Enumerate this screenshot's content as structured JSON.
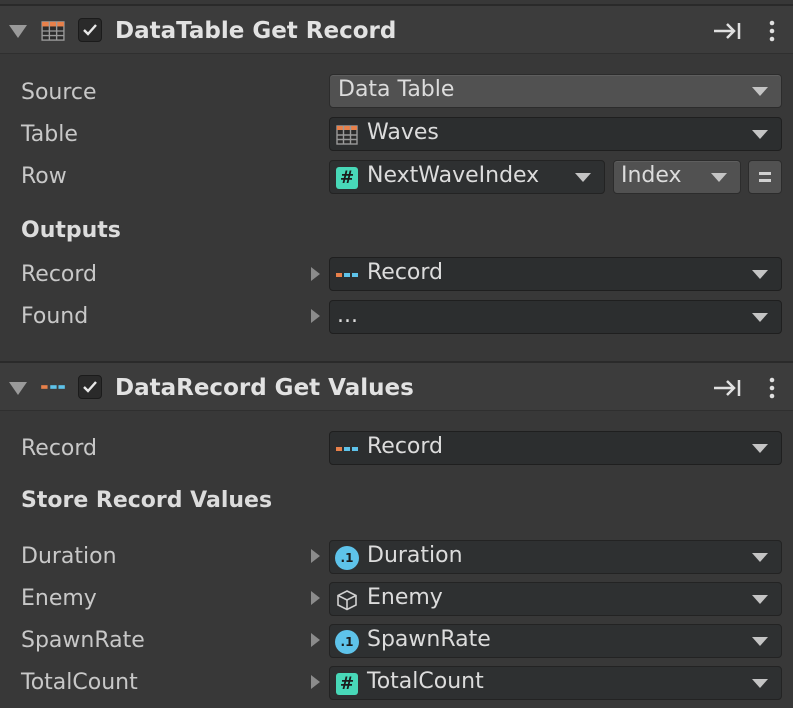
{
  "section1": {
    "title": "DataTable Get Record",
    "fields": {
      "source": {
        "label": "Source",
        "value": "Data Table"
      },
      "table": {
        "label": "Table",
        "value": "Waves"
      },
      "row": {
        "label": "Row",
        "value": "NextWaveIndex",
        "mode": "Index"
      }
    },
    "outputs_heading": "Outputs",
    "outputs": {
      "record": {
        "label": "Record",
        "value": "Record"
      },
      "found": {
        "label": "Found",
        "value": "..."
      }
    }
  },
  "section2": {
    "title": "DataRecord Get Values",
    "record": {
      "label": "Record",
      "value": "Record"
    },
    "store_heading": "Store Record Values",
    "values": [
      {
        "label": "Duration",
        "value": "Duration",
        "icon": "float-icon"
      },
      {
        "label": "Enemy",
        "value": "Enemy",
        "icon": "cube-icon"
      },
      {
        "label": "SpawnRate",
        "value": "SpawnRate",
        "icon": "float-icon"
      },
      {
        "label": "TotalCount",
        "value": "TotalCount",
        "icon": "hash-icon"
      }
    ]
  },
  "icons": {
    "float_glyph": ".1",
    "hash_glyph": "#"
  },
  "colors": {
    "hash_accent": "#48d8b8",
    "float_accent": "#5ec3ea",
    "record_orange": "#e8804a",
    "record_cyan": "#5ec3ea"
  }
}
